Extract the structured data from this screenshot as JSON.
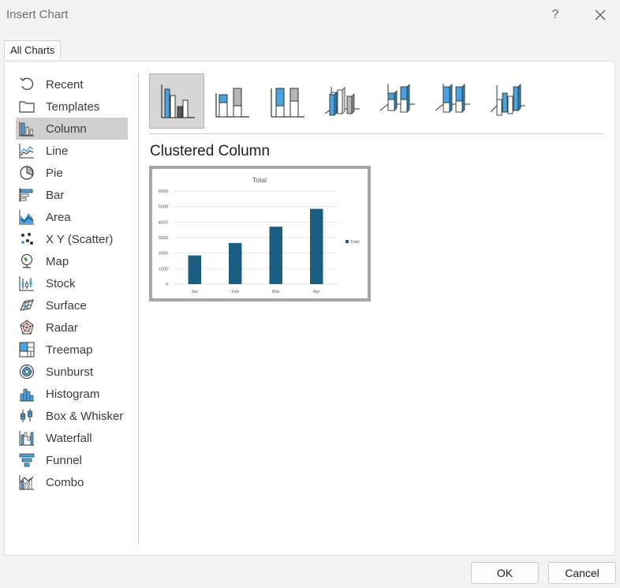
{
  "window": {
    "title": "Insert Chart",
    "help": "?"
  },
  "tabs": [
    {
      "label": "All Charts"
    }
  ],
  "chart_types": [
    {
      "label": "Recent",
      "icon": "recent-icon"
    },
    {
      "label": "Templates",
      "icon": "folder-icon"
    },
    {
      "label": "Column",
      "icon": "column-chart-icon",
      "selected": true
    },
    {
      "label": "Line",
      "icon": "line-chart-icon"
    },
    {
      "label": "Pie",
      "icon": "pie-chart-icon"
    },
    {
      "label": "Bar",
      "icon": "bar-chart-icon"
    },
    {
      "label": "Area",
      "icon": "area-chart-icon"
    },
    {
      "label": "X Y (Scatter)",
      "icon": "scatter-chart-icon"
    },
    {
      "label": "Map",
      "icon": "map-chart-icon"
    },
    {
      "label": "Stock",
      "icon": "stock-chart-icon"
    },
    {
      "label": "Surface",
      "icon": "surface-chart-icon"
    },
    {
      "label": "Radar",
      "icon": "radar-chart-icon"
    },
    {
      "label": "Treemap",
      "icon": "treemap-chart-icon"
    },
    {
      "label": "Sunburst",
      "icon": "sunburst-chart-icon"
    },
    {
      "label": "Histogram",
      "icon": "histogram-chart-icon"
    },
    {
      "label": "Box & Whisker",
      "icon": "box-whisker-chart-icon"
    },
    {
      "label": "Waterfall",
      "icon": "waterfall-chart-icon"
    },
    {
      "label": "Funnel",
      "icon": "funnel-chart-icon"
    },
    {
      "label": "Combo",
      "icon": "combo-chart-icon"
    }
  ],
  "subtypes": [
    {
      "icon": "clustered-column-icon",
      "selected": true
    },
    {
      "icon": "stacked-column-icon"
    },
    {
      "icon": "100-stacked-column-icon"
    },
    {
      "icon": "3d-clustered-column-icon"
    },
    {
      "icon": "3d-stacked-column-icon"
    },
    {
      "icon": "3d-100-stacked-column-icon"
    },
    {
      "icon": "3d-column-icon"
    }
  ],
  "selected_subtype_name": "Clustered Column",
  "colors": {
    "accent": "#1b5e82",
    "selection": "#cfcfcf",
    "icon_blue": "#4aa3df"
  },
  "chart_data": {
    "type": "bar",
    "title": "Total",
    "categories": [
      "Jan",
      "Feb",
      "Mar",
      "Apr"
    ],
    "series": [
      {
        "name": "Total",
        "values": [
          1850,
          2650,
          3700,
          4850
        ]
      }
    ],
    "ylim": [
      0,
      6000
    ],
    "yticks": [
      0,
      1000,
      2000,
      3000,
      4000,
      5000,
      6000
    ],
    "grid": true,
    "legend": "right"
  },
  "buttons": {
    "ok": "OK",
    "cancel": "Cancel"
  }
}
